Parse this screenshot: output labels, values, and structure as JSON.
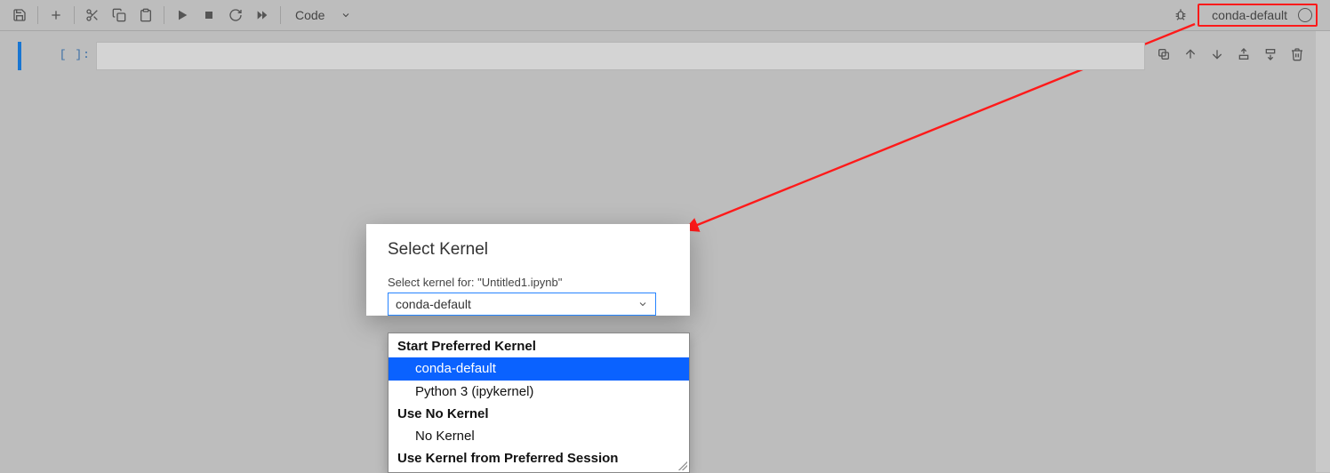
{
  "toolbar": {
    "cell_type_label": "Code"
  },
  "kernel": {
    "name": "conda-default"
  },
  "cell": {
    "prompt": "[ ]:"
  },
  "dialog": {
    "title": "Select Kernel",
    "label": "Select kernel for: \"Untitled1.ipynb\"",
    "selected": "conda-default",
    "groups": [
      {
        "label": "Start Preferred Kernel",
        "options": [
          "conda-default",
          "Python 3 (ipykernel)"
        ],
        "highlight": "conda-default"
      },
      {
        "label": "Use No Kernel",
        "options": [
          "No Kernel"
        ]
      },
      {
        "label": "Use Kernel from Preferred Session",
        "options": []
      }
    ]
  }
}
